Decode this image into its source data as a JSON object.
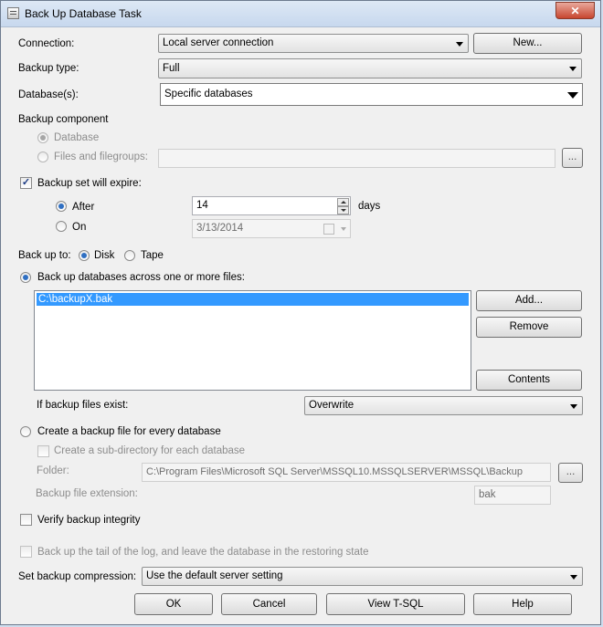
{
  "window": {
    "title": "Back Up Database Task",
    "close_glyph": "✕"
  },
  "connection": {
    "label": "Connection:",
    "value": "Local server connection",
    "new_button": "New..."
  },
  "backup_type": {
    "label": "Backup type:",
    "value": "Full"
  },
  "databases": {
    "label": "Database(s):",
    "value": "Specific databases"
  },
  "backup_component": {
    "label": "Backup component",
    "database_option": "Database",
    "files_option": "Files and filegroups:",
    "browse_button": "..."
  },
  "expire": {
    "label": "Backup set will expire:",
    "checked_glyph": "✓",
    "after_label": "After",
    "after_value": "14",
    "days_label": "days",
    "on_label": "On",
    "on_value": "3/13/2014"
  },
  "backup_to": {
    "label": "Back up to:",
    "disk_label": "Disk",
    "tape_label": "Tape"
  },
  "across_files": {
    "label": "Back up databases across one or more files:",
    "files": [
      "C:\\backupX.bak"
    ],
    "add_button": "Add...",
    "remove_button": "Remove",
    "contents_button": "Contents"
  },
  "if_exists": {
    "label": "If backup files exist:",
    "value": "Overwrite"
  },
  "per_database": {
    "label": "Create a backup file for every database",
    "subdir_label": "Create a sub-directory for each database",
    "folder_label": "Folder:",
    "folder_value": "C:\\Program Files\\Microsoft SQL Server\\MSSQL10.MSSQLSERVER\\MSSQL\\Backup",
    "folder_browse": "...",
    "extension_label": "Backup file extension:",
    "extension_value": "bak"
  },
  "verify": {
    "label": "Verify backup integrity"
  },
  "tail_log": {
    "label": "Back up the tail of the log, and leave the database in the restoring state"
  },
  "compression": {
    "label": "Set backup compression:",
    "value": "Use the default server setting"
  },
  "footer": {
    "ok": "OK",
    "cancel": "Cancel",
    "view_tsql": "View T-SQL",
    "help": "Help"
  }
}
